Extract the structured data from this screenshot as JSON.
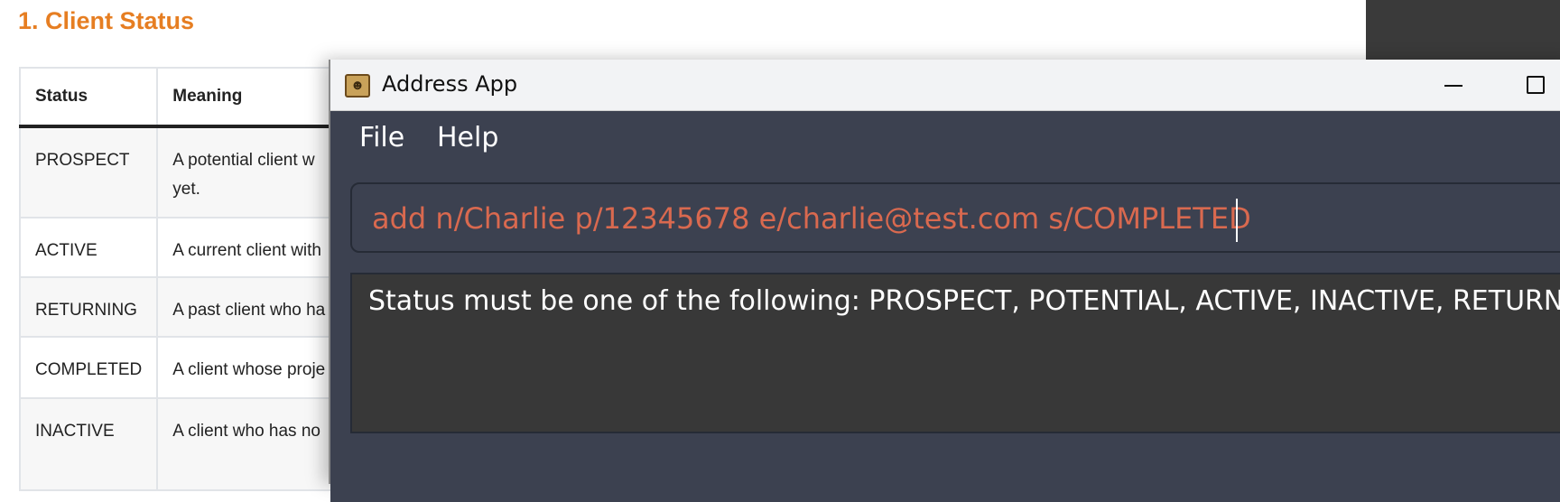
{
  "doc": {
    "title": "1. Client Status",
    "table": {
      "headers": [
        "Status",
        "Meaning"
      ],
      "rows": [
        {
          "status": "PROSPECT",
          "meaning": "A potential client w",
          "meaning2": "yet."
        },
        {
          "status": "ACTIVE",
          "meaning": "A current client with"
        },
        {
          "status": "RETURNING",
          "meaning": "A past client who ha"
        },
        {
          "status": "COMPLETED",
          "meaning": "A client whose proje"
        },
        {
          "status": "INACTIVE",
          "meaning": "A client who has no"
        }
      ]
    }
  },
  "app": {
    "title": "Address App",
    "icon": "address-book-icon",
    "menu": {
      "file": "File",
      "help": "Help"
    },
    "command": {
      "value": "add n/Charlie p/12345678 e/charlie@test.com s/COMPLETED"
    },
    "result": "Status must be one of the following: PROSPECT, POTENTIAL, ACTIVE, INACTIVE, RETURNING"
  },
  "colors": {
    "heading": "#e67e22",
    "app_bg": "#3c4150",
    "command_text": "#d9694f",
    "result_bg": "#383838"
  }
}
